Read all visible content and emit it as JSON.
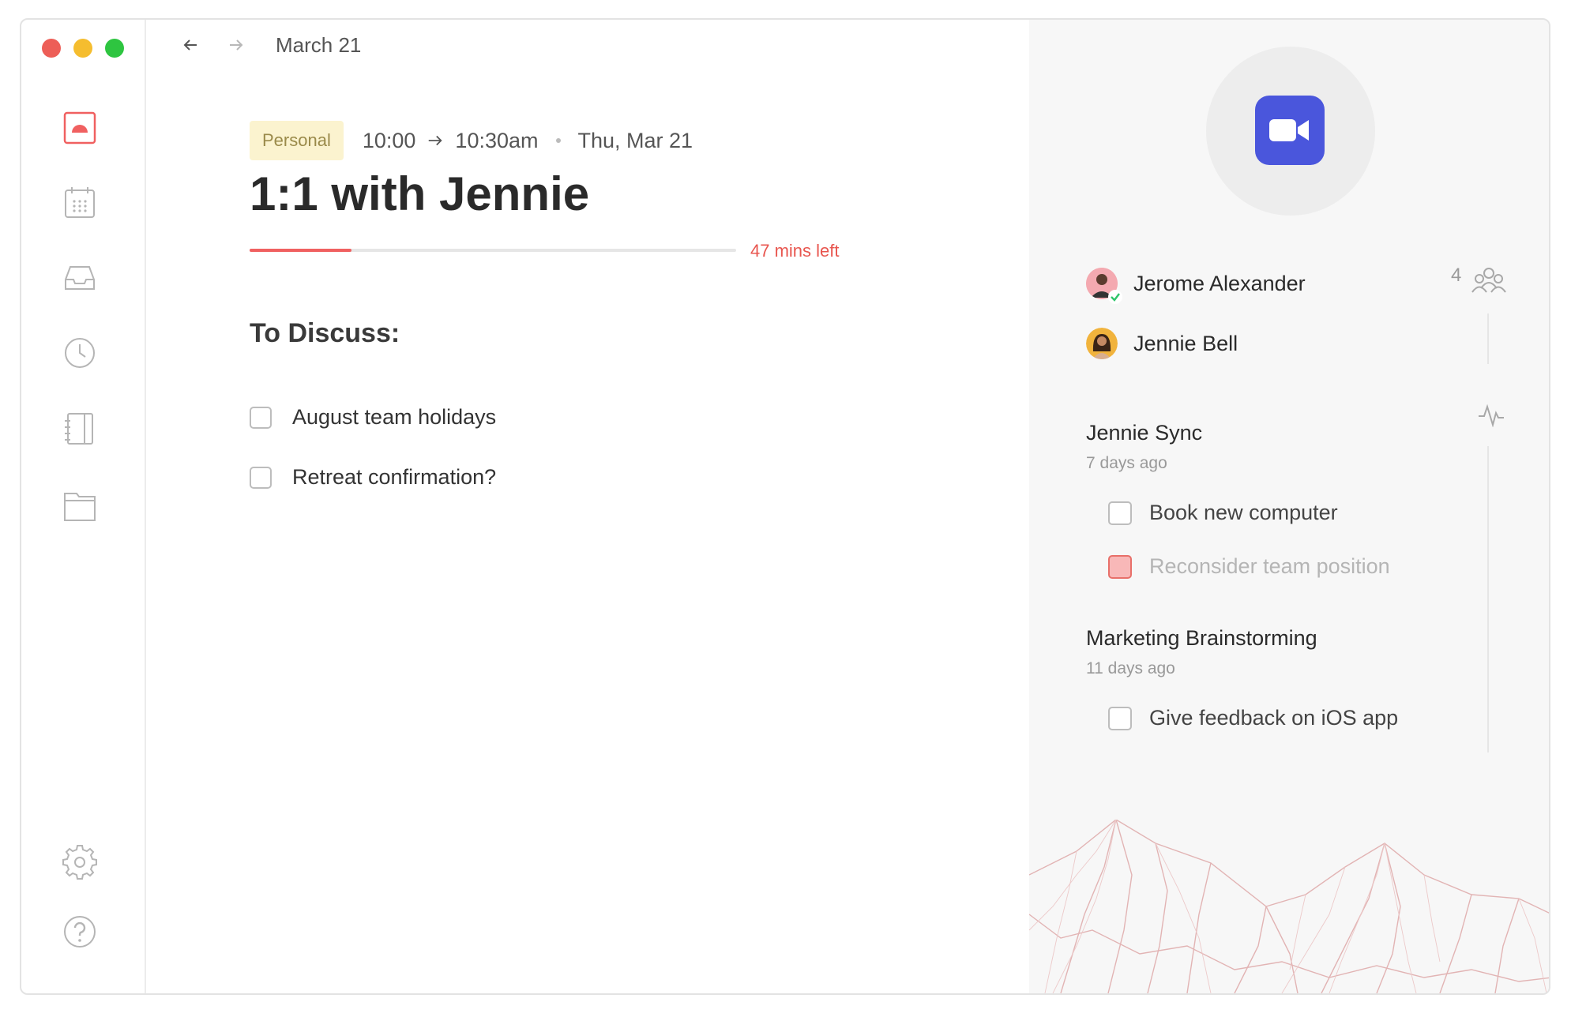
{
  "header": {
    "breadcrumb": "March 21"
  },
  "event": {
    "tag": "Personal",
    "start": "10:00",
    "end": "10:30am",
    "date": "Thu, Mar 21",
    "title": "1:1 with Jennie",
    "progress_fraction": 0.21,
    "time_left": "47 mins left"
  },
  "discuss": {
    "heading": "To Discuss:",
    "items": [
      {
        "label": "August team holidays",
        "checked": false
      },
      {
        "label": "Retreat confirmation?",
        "checked": false
      }
    ]
  },
  "attendees": {
    "count": "4",
    "people": [
      {
        "name": "Jerome Alexander"
      },
      {
        "name": "Jennie Bell"
      }
    ]
  },
  "history": [
    {
      "title": "Jennie Sync",
      "when": "7 days ago",
      "items": [
        {
          "label": "Book new computer",
          "checked": false
        },
        {
          "label": "Reconsider team position",
          "checked": true
        }
      ]
    },
    {
      "title": "Marketing Brainstorming",
      "when": "11 days ago",
      "items": [
        {
          "label": "Give feedback on iOS app",
          "checked": false
        }
      ]
    }
  ],
  "colors": {
    "accent": "#f06060",
    "video": "#4a56dc",
    "tag_bg": "#fbf3cf",
    "red_check_bg": "#f8b8b8",
    "red_check_border": "#e8706a"
  },
  "icons": {
    "sidebar": [
      "today-icon",
      "calendar-icon",
      "inbox-icon",
      "clock-icon",
      "notebook-icon",
      "folder-icon",
      "gear-icon",
      "help-icon"
    ],
    "panel": [
      "video-camera-icon",
      "people-icon",
      "activity-icon"
    ]
  }
}
